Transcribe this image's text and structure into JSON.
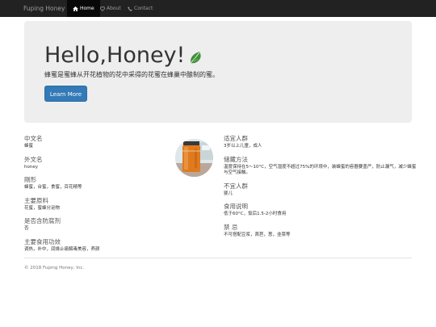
{
  "nav": {
    "brand": "Fuping Honey",
    "items": [
      {
        "label": "Home",
        "icon": "home-icon",
        "active": true
      },
      {
        "label": "About",
        "icon": "heart-icon",
        "active": false
      },
      {
        "label": "Contact",
        "icon": "phone-icon",
        "active": false
      }
    ]
  },
  "hero": {
    "title": "Hello,Honey!",
    "subtitle": "蜂蜜是蜜蜂从开花植物的花中采得的花蜜在蜂巢中酿制的蜜。",
    "button_label": "Learn More"
  },
  "left": [
    {
      "heading": "中文名",
      "value": "蜂蜜"
    },
    {
      "heading": "外文名",
      "value": "honey"
    },
    {
      "heading": "剛形",
      "value": "蜂蜜，台蜜，食蜜，百花精等"
    },
    {
      "heading": "主要原料",
      "value": "花蜜，蜜蜂分泌物"
    },
    {
      "heading": "是否含防腐剂",
      "value": "否"
    },
    {
      "heading": "主要食用功效",
      "value": "调热，补中，润燥止痛解毒美容，养颜"
    }
  ],
  "right": [
    {
      "heading": "适宜人群",
      "value": "3岁以上儿童，成人"
    },
    {
      "heading": "储藏方法",
      "value": "温度保持在5～10°C，空气湿度不超过75%的环境中，装蜂蜜的容器要盖严，防止漏气，减少蜂蜜与空气接触。"
    },
    {
      "heading": "不宜人群",
      "value": "婴儿"
    },
    {
      "heading": "食用说明",
      "value": "低于60°C，饭后1.5-2小时食用"
    },
    {
      "heading": "禁 忌",
      "value": "不可搭配豆浆，莴苣，葱，韭菜等"
    }
  ],
  "footer": {
    "text": "© 2018 Fuping Honey, Inc."
  },
  "colors": {
    "navbar": "#222222",
    "primary": "#337ab7",
    "jumbotron": "#eeeeee",
    "honey": "#e8862a"
  }
}
